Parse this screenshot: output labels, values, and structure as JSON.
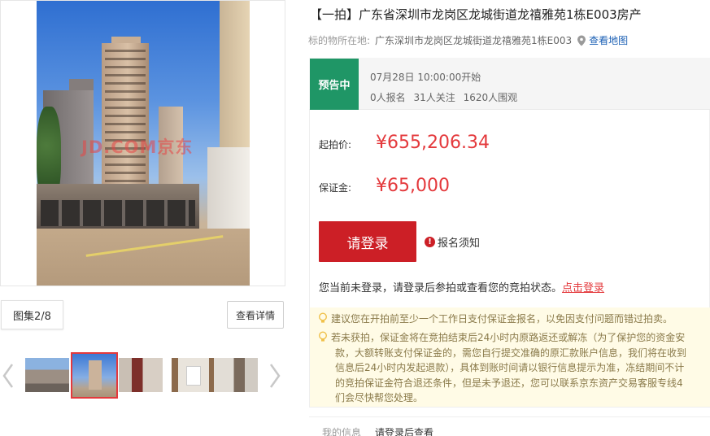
{
  "watermark_text": "JD.COM京东",
  "gallery": {
    "count_label": "图集2/8",
    "detail_button": "查看详情",
    "thumbnails": [
      "thumb-1",
      "thumb-2",
      "thumb-3",
      "thumb-4",
      "thumb-5"
    ],
    "active_index": 1
  },
  "title": "【一拍】广东省深圳市龙岗区龙城街道龙禧雅苑1栋E003房产",
  "location": {
    "label": "标的物所在地:",
    "value": "广东深圳市龙岗区龙城街道龙禧雅苑1栋E003",
    "map_link": "查看地图"
  },
  "status": {
    "tag": "预告中",
    "time": "07月28日 10:00:00开始",
    "signup": "0人报名",
    "followers": "31人关注",
    "viewers": "1620人围观"
  },
  "prices": {
    "start_label": "起拍价:",
    "start_value": "¥655,206.34",
    "deposit_label": "保证金:",
    "deposit_value": "¥65,000"
  },
  "actions": {
    "login_button": "请登录",
    "notice_icon": "!",
    "notice_label": "报名须知"
  },
  "login_hint": {
    "text": "您当前未登录，请登录后参拍或查看您的竞拍状态。",
    "link": "点击登录"
  },
  "tips": {
    "tip1": "建议您在开拍前至少一个工作日支付保证金报名，以免因支付问题而错过拍卖。",
    "tip2_line1": "若未获拍，保证金将在竞拍结束后24小时内原路返还或解冻（为了保护您的资金安",
    "tip2_line2": "款，大额转账支付保证金的，需您自行提交准确的原汇款账户信息，我们将在收到",
    "tip2_line3": "信息后24小时内发起退款），具体到账时间请以银行信息提示为准，冻结期间不计",
    "tip2_line4": "的竞拍保证金符合退还条件，但是未予退还，您可以联系京东资产交易客服专线4",
    "tip2_line5": "们会尽快帮您处理。"
  },
  "my_info": {
    "label": "我的信息",
    "value": "请登录后查看"
  },
  "colors": {
    "accent_red": "#e4393c",
    "button_red": "#cc1f26",
    "status_green": "#1f9666",
    "link_blue": "#1a5fb4",
    "tip_bg": "#fffbe6"
  }
}
